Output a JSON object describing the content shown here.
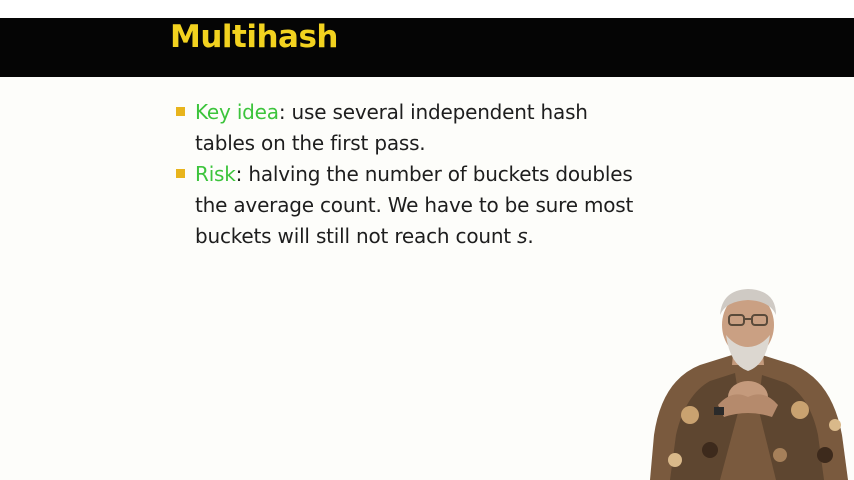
{
  "slide": {
    "title": "Multihash",
    "bullets": [
      {
        "keyword": "Key idea",
        "rest_line1": ": use several independent hash",
        "line2": "tables on the first pass."
      },
      {
        "keyword": "Risk",
        "rest_line1": ": halving the number of buckets doubles",
        "line2": "the average count.  We have to be sure most",
        "line3_pre": "buckets will still not reach count ",
        "line3_var": "s",
        "line3_post": "."
      }
    ]
  },
  "colors": {
    "title_bar": "#050505",
    "title_text": "#f2d21f",
    "keyword": "#3cc43c",
    "bullet_square": "#e8b41c",
    "body_text": "#1e1e1e"
  }
}
